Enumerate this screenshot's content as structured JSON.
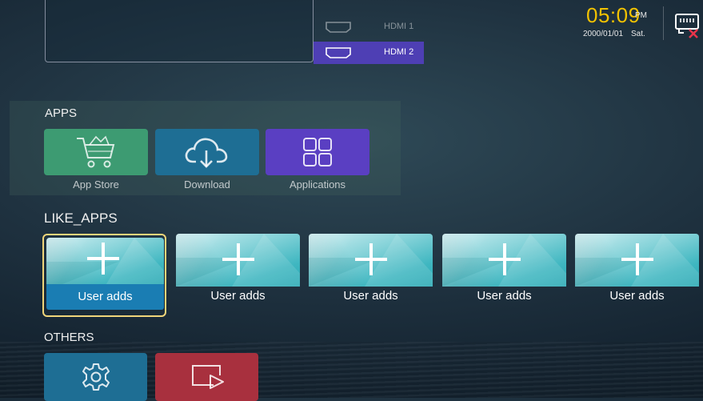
{
  "sources": {
    "items": [
      {
        "label": "HDMI 1",
        "active": false
      },
      {
        "label": "HDMI 2",
        "active": true
      }
    ]
  },
  "status": {
    "time": "05:09",
    "ampm": "PM",
    "date": "2000/01/01",
    "day": "Sat.",
    "network_icon": "ethernet-disconnected-icon"
  },
  "apps": {
    "title": "APPS",
    "items": [
      {
        "label": "App Store",
        "icon": "shopping-cart-icon",
        "color": "#3d9b72"
      },
      {
        "label": "Download",
        "icon": "cloud-download-icon",
        "color": "#1e6e94"
      },
      {
        "label": "Applications",
        "icon": "grid-icon",
        "color": "#5a3fc2"
      }
    ]
  },
  "like_apps": {
    "title": "LIKE_APPS",
    "items": [
      {
        "label": "User adds",
        "focused": true
      },
      {
        "label": "User adds",
        "focused": false
      },
      {
        "label": "User adds",
        "focused": false
      },
      {
        "label": "User adds",
        "focused": false
      },
      {
        "label": "User adds",
        "focused": false
      }
    ]
  },
  "others": {
    "title": "OTHERS",
    "items": [
      {
        "icon": "settings-gear-icon",
        "color": "#1e6e94"
      },
      {
        "icon": "media-player-icon",
        "color": "#a8303e"
      }
    ]
  },
  "colors": {
    "clock_accent": "#f2c200",
    "focus_border": "#f0d57a",
    "focus_label_bg": "#1a7db3",
    "active_source": "#4e3fb4"
  }
}
